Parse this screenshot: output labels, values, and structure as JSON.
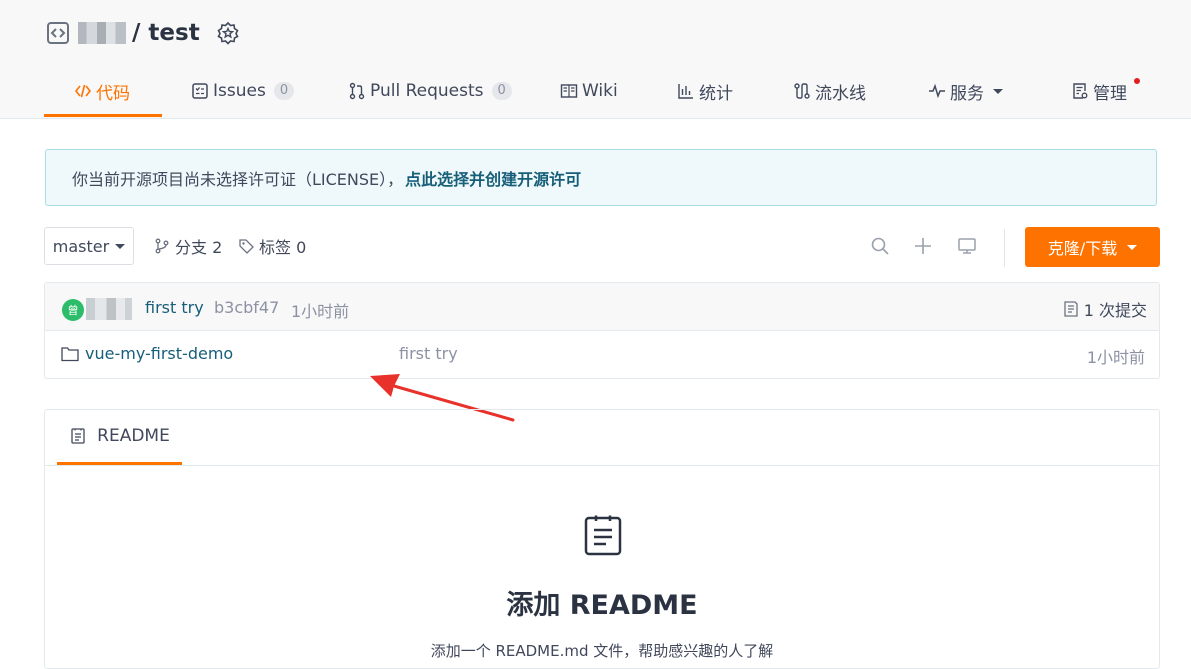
{
  "repo": {
    "owner_display": "",
    "name": "/ test"
  },
  "tabs": [
    {
      "label": "代码"
    },
    {
      "label": "Issues",
      "badge": "0"
    },
    {
      "label": "Pull Requests",
      "badge": "0"
    },
    {
      "label": "Wiki"
    },
    {
      "label": "统计"
    },
    {
      "label": "流水线"
    },
    {
      "label": "服务"
    },
    {
      "label": "管理"
    }
  ],
  "notice": {
    "text": "你当前开源项目尚未选择许可证（LICENSE），",
    "link": "点此选择并创建开源许可"
  },
  "toolbar": {
    "branch": "master",
    "branches_label": "分支 2",
    "tags_label": "标签 0",
    "clone_label": "克隆/下载"
  },
  "commit": {
    "avatar_char": "曾",
    "message": "first try",
    "hash": "b3cbf47",
    "time": "1小时前",
    "count_label": "1 次提交"
  },
  "files": [
    {
      "name": "vue-my-first-demo",
      "message": "first try",
      "time": "1小时前"
    }
  ],
  "readme": {
    "tab_label": "README",
    "title": "添加 README",
    "subtitle": "添加一个 README.md 文件，帮助感兴趣的人了解"
  },
  "colors": {
    "accent": "#fe7300",
    "link": "#175e79",
    "notice_bg": "#eff9fb",
    "annotation_arrow": "#e8312a"
  }
}
